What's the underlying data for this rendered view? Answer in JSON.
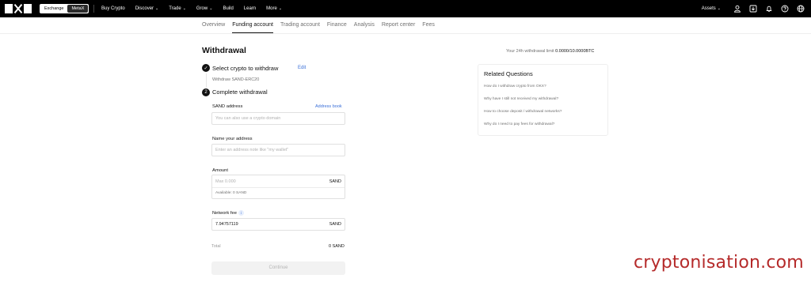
{
  "nav": {
    "switch_exchange": "Exchange",
    "switch_metax": "MetaX",
    "items": [
      {
        "label": "Buy Crypto",
        "chevron": false
      },
      {
        "label": "Discover",
        "chevron": true
      },
      {
        "label": "Trade",
        "chevron": true
      },
      {
        "label": "Grow",
        "chevron": true
      },
      {
        "label": "Build",
        "chevron": false
      },
      {
        "label": "Learn",
        "chevron": false
      },
      {
        "label": "More",
        "chevron": true
      }
    ],
    "assets": "Assets",
    "icons": [
      "user-icon",
      "download-icon",
      "bell-icon",
      "help-icon",
      "globe-icon"
    ]
  },
  "tabs": [
    "Overview",
    "Funding account",
    "Trading account",
    "Finance",
    "Analysis",
    "Report center",
    "Fees"
  ],
  "active_tab": "Funding account",
  "page": {
    "title": "Withdrawal",
    "limit_label": "Your 24h withdrawal limit",
    "limit_value": "0.0000/10.0000BTC"
  },
  "step1": {
    "number": "✓",
    "title": "Select crypto to withdraw",
    "edit": "Edit",
    "sub": "Withdraw SAND-ERC20"
  },
  "step2": {
    "number": "2",
    "title": "Complete withdrawal"
  },
  "form": {
    "address_label": "SAND address",
    "address_book": "Address book",
    "address_placeholder": "You can also use a crypto domain",
    "name_label": "Name your address",
    "name_placeholder": "Enter an address note like \"my wallet\"",
    "amount_label": "Amount",
    "amount_placeholder": "Max 0.000",
    "amount_unit": "SAND",
    "available": "Available: 0 SAND",
    "fee_label": "Network fee",
    "fee_value": "7.94757119",
    "fee_unit": "SAND",
    "total_label": "Total",
    "total_value": "0 SAND",
    "continue": "Continue"
  },
  "related": {
    "title": "Related Questions",
    "questions": [
      "How do I withdraw crypto from OKX?",
      "Why have I still not received my withdrawal?",
      "How to choose deposit / withdrawal networks?",
      "Why do I need to pay fees for withdrawal?"
    ]
  },
  "watermark": "cryptonisation.com"
}
